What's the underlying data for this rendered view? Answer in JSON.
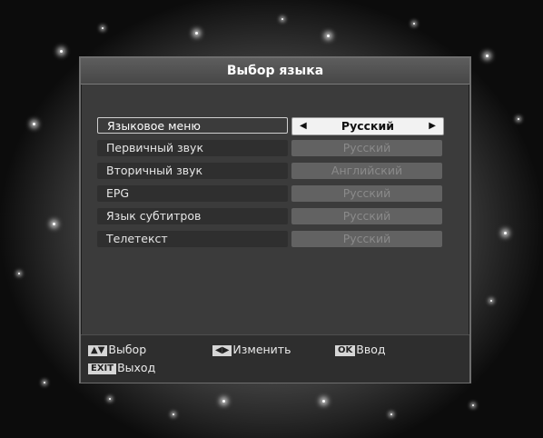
{
  "dialog": {
    "title": "Выбор языка"
  },
  "settings": [
    {
      "label": "Языковое меню",
      "value": "Русский",
      "selected": true
    },
    {
      "label": "Первичный звук",
      "value": "Русский",
      "selected": false
    },
    {
      "label": "Вторичный звук",
      "value": "Английский",
      "selected": false
    },
    {
      "label": "EPG",
      "value": "Русский",
      "selected": false
    },
    {
      "label": "Язык субтитров",
      "value": "Русский",
      "selected": false
    },
    {
      "label": "Телетекст",
      "value": "Русский",
      "selected": false
    }
  ],
  "footer": {
    "select_label": "Выбор",
    "change_label": "Изменить",
    "ok_key": "OK",
    "enter_label": "Ввод",
    "exit_key": "EXIT",
    "exit_label": "Выход"
  },
  "icons": {
    "up_down": "up-down-arrows-icon",
    "left_right": "left-right-arrows-icon",
    "arrow_left": "arrow-left-icon",
    "arrow_right": "arrow-right-icon"
  },
  "colors": {
    "selected_value_bg": "#f2f2f2",
    "inactive_value_bg": "#626262",
    "panel_bg": "#3b3b3b"
  }
}
